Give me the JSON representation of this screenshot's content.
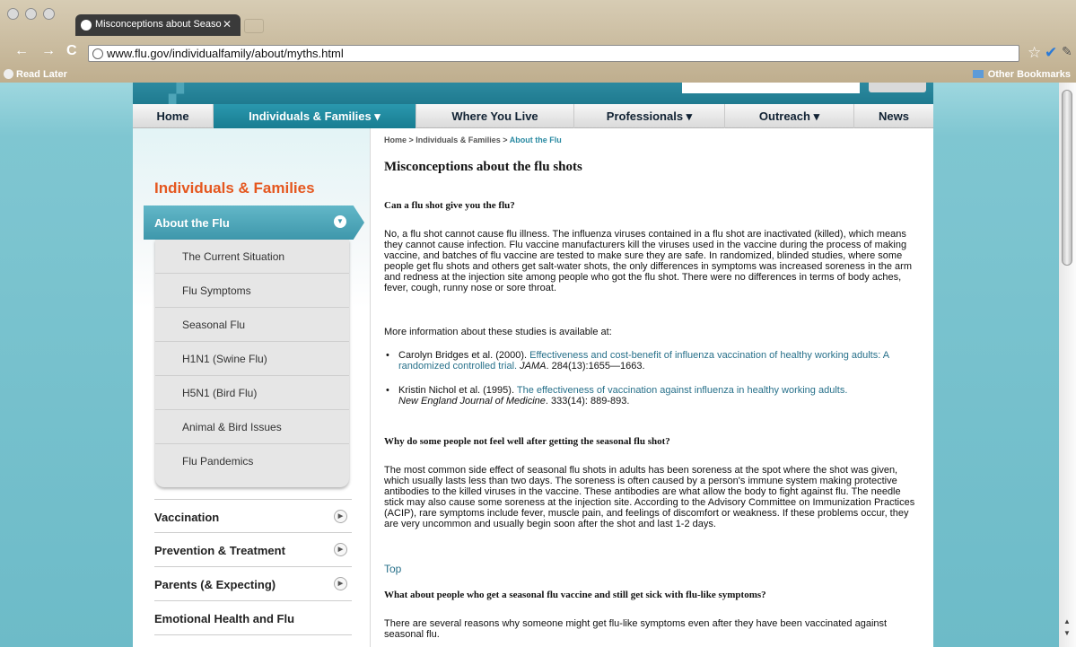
{
  "browser": {
    "tab_title": "Misconceptions about Seaso",
    "url": "www.flu.gov/individualfamily/about/myths.html",
    "bookmarks_left": "Read Later",
    "bookmarks_right": "Other Bookmarks"
  },
  "nav": {
    "items": [
      "Home",
      "Individuals & Families ▾",
      "Where You Live",
      "Professionals ▾",
      "Outreach ▾",
      "News"
    ]
  },
  "sidebar": {
    "title": "Individuals & Families",
    "active": "About the Flu",
    "subitems": [
      "The Current Situation",
      "Flu Symptoms",
      "Seasonal Flu",
      "H1N1 (Swine Flu)",
      "H5N1 (Bird Flu)",
      "Animal & Bird Issues",
      "Flu Pandemics"
    ],
    "sections": [
      "Vaccination",
      "Prevention & Treatment",
      "Parents (& Expecting)",
      "Emotional Health and Flu"
    ]
  },
  "content": {
    "breadcrumb_prefix": "Home > Individuals & Families > ",
    "breadcrumb_current": "About the Flu",
    "title": "Misconceptions about the flu shots",
    "q1": "Can a flu shot give you the flu?",
    "p1": "No, a flu shot cannot cause flu illness. The influenza viruses contained in a flu shot are inactivated (killed), which means they cannot cause infection. Flu vaccine manufacturers kill the viruses used in the vaccine during the process of making vaccine, and batches of flu vaccine are tested to make sure they are safe. In randomized, blinded studies, where some people get flu shots and others get salt-water shots, the only differences in symptoms was increased soreness in the arm and redness at the injection site among people who got the flu shot. There were no differences in terms of body aches, fever, cough, runny nose or sore throat.",
    "p2": "More information about these studies is available at:",
    "ref1_author": "Carolyn Bridges et al. (2000). ",
    "ref1_link": "Effectiveness and cost-benefit of influenza vaccination of healthy working adults: A randomized controlled trial.",
    "ref1_journal": " JAMA",
    "ref1_rest": ". 284(13):1655—1663.",
    "ref2_author": "Kristin Nichol et al. (1995). ",
    "ref2_link": "The effectiveness of vaccination against influenza in healthy working adults.",
    "ref2_journal": "New England Journal of Medicine",
    "ref2_rest": ". 333(14): 889-893.",
    "q2": "Why do some people not feel well after getting the seasonal flu shot?",
    "p3": "The most common side effect of seasonal flu shots in adults has been soreness at the spot where the shot was given, which usually lasts less than two days. The soreness is often caused by a person's immune system making protective antibodies to the killed viruses in the vaccine. These antibodies are what allow the body to fight against flu. The needle stick may also cause some soreness at the injection site. According to the Advisory Committee on Immunization Practices (ACIP), rare symptoms include fever, muscle pain, and feelings of discomfort or weakness. If these problems occur, they are very uncommon and usually begin soon after the shot and last 1-2 days.",
    "top": "Top",
    "q3": "What about people who get a seasonal flu vaccine and still get sick with flu-like symptoms?",
    "p4": "There are several reasons why someone might get flu-like symptoms even after they have been vaccinated against seasonal flu."
  }
}
